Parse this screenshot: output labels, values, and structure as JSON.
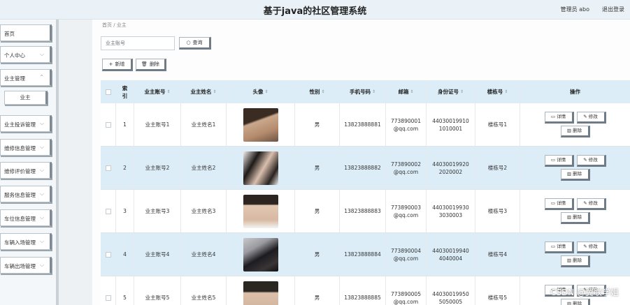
{
  "header": {
    "title": "基于java的社区管理系统",
    "user": "管理员 abo",
    "logout": "退出登录"
  },
  "sidebar": {
    "items": [
      {
        "label": "首页"
      },
      {
        "label": "个人中心"
      },
      {
        "label": "业主管理"
      },
      {
        "label": "业主"
      },
      {
        "label": "业主投诉管理"
      },
      {
        "label": "维修信息管理"
      },
      {
        "label": "维修评价管理"
      },
      {
        "label": "服务信息管理"
      },
      {
        "label": "车位信息管理"
      },
      {
        "label": "车辆入场管理"
      },
      {
        "label": "车辆出场管理"
      }
    ]
  },
  "breadcrumb": "首页 / 业主",
  "search": {
    "placeholder": "业主账号",
    "button": "查询"
  },
  "toolbar": {
    "add": "新增",
    "delete": "删除"
  },
  "table": {
    "headers": [
      "索引",
      "业主账号",
      "业主姓名",
      "头像",
      "性别",
      "手机号码",
      "邮箱",
      "身份证号",
      "楼栋号",
      "操作"
    ],
    "rows": [
      {
        "index": "1",
        "account": "业主账号1",
        "name": "业主姓名1",
        "gender": "男",
        "phone": "13823888881",
        "email": "773890001@qq.com",
        "idcard": "440300199101010001",
        "building": "楼栋号1"
      },
      {
        "index": "2",
        "account": "业主账号2",
        "name": "业主姓名2",
        "gender": "男",
        "phone": "13823888882",
        "email": "773890002@qq.com",
        "idcard": "440300199202020002",
        "building": "楼栋号2"
      },
      {
        "index": "3",
        "account": "业主账号3",
        "name": "业主姓名3",
        "gender": "男",
        "phone": "13823888883",
        "email": "773890003@qq.com",
        "idcard": "440300199303030003",
        "building": "楼栋号3"
      },
      {
        "index": "4",
        "account": "业主账号4",
        "name": "业主姓名4",
        "gender": "男",
        "phone": "13823888884",
        "email": "773890004@qq.com",
        "idcard": "440300199404040004",
        "building": "楼栋号4"
      },
      {
        "index": "5",
        "account": "业主账号5",
        "name": "业主姓名5",
        "gender": "男",
        "phone": "13823888885",
        "email": "773890005@qq.com",
        "idcard": "440300199505050005",
        "building": "楼栋号5"
      }
    ],
    "actions": {
      "detail": "详情",
      "edit": "修改",
      "delete": "删除"
    }
  },
  "watermark": "CSDN @翼联学姐",
  "colors": {
    "header_row": "#dcedf8",
    "alt_row": "#dcedf8",
    "topbar": "#eaf2f7"
  }
}
